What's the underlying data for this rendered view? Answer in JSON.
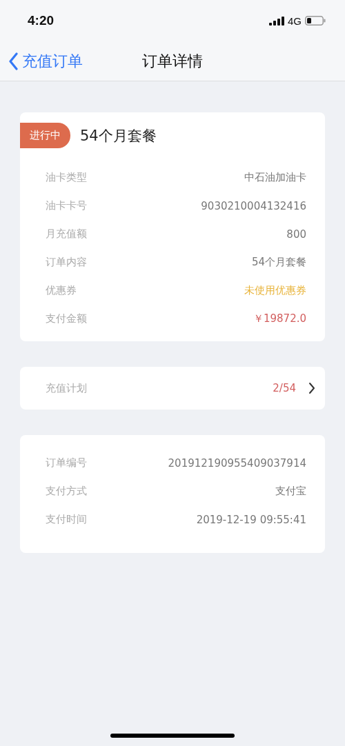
{
  "status_bar": {
    "time": "4:20",
    "network": "4G"
  },
  "nav": {
    "back_label": "充值订单",
    "title": "订单详情"
  },
  "order": {
    "status": "进行中",
    "title": "54个月套餐",
    "rows": [
      {
        "label": "油卡类型",
        "value": "中石油加油卡",
        "kind": "normal"
      },
      {
        "label": "油卡卡号",
        "value": "9030210004132416",
        "kind": "normal"
      },
      {
        "label": "月充值额",
        "value": "800",
        "kind": "normal"
      },
      {
        "label": "订单内容",
        "value": "54个月套餐",
        "kind": "normal"
      },
      {
        "label": "优惠券",
        "value": "未使用优惠券",
        "kind": "coupon"
      },
      {
        "label": "支付金额",
        "value": "￥19872.0",
        "kind": "price"
      }
    ]
  },
  "plan": {
    "label": "充值计划",
    "value": "2/54"
  },
  "payment": {
    "rows": [
      {
        "label": "订单编号",
        "value": "201912190955409037914"
      },
      {
        "label": "支付方式",
        "value": "支付宝"
      },
      {
        "label": "支付时间",
        "value": "2019-12-19 09:55:41"
      }
    ]
  }
}
